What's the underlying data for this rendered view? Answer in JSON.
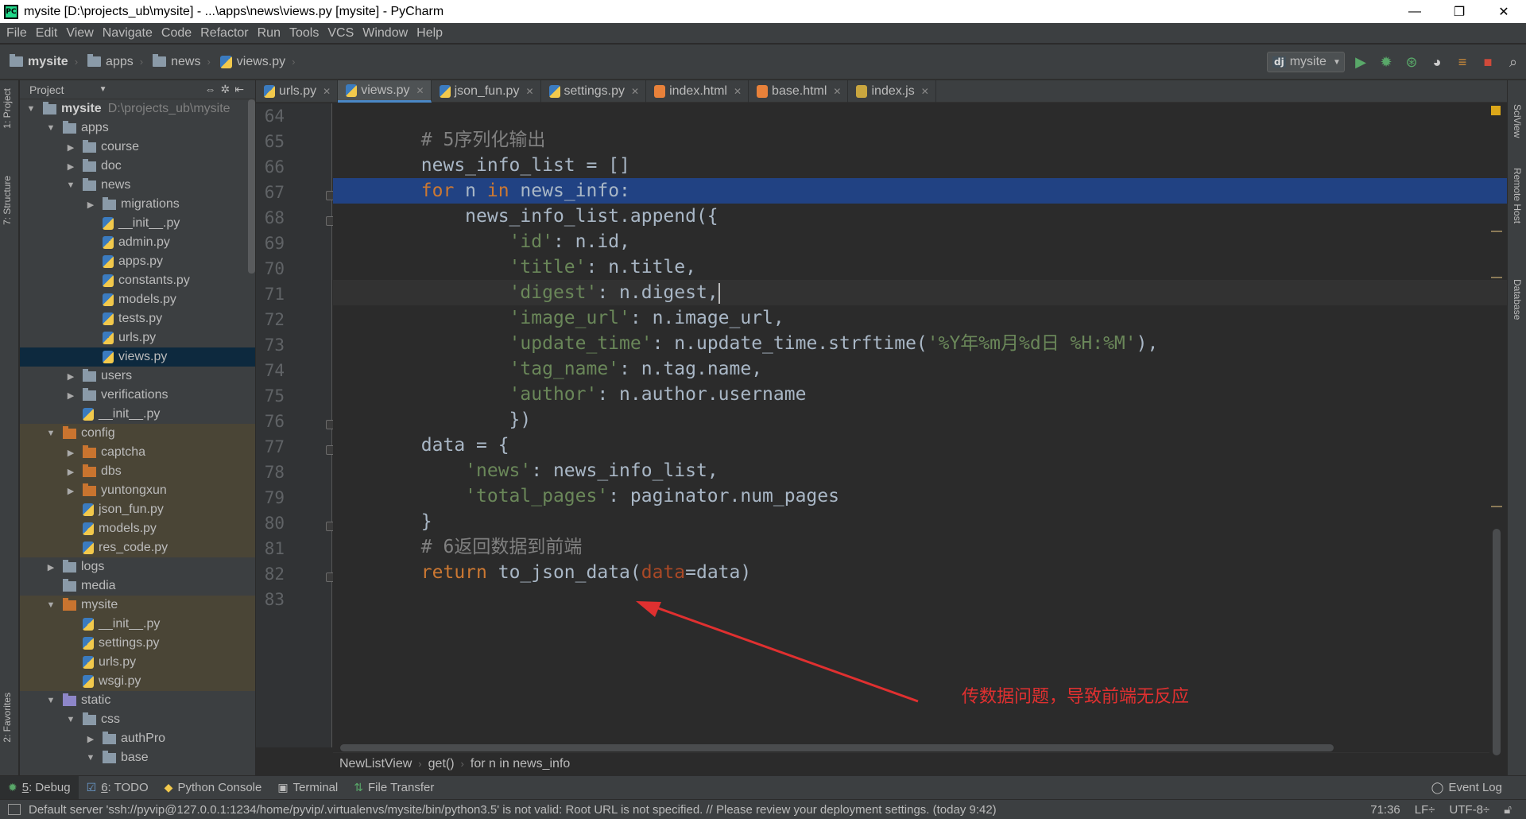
{
  "window": {
    "title": "mysite [D:\\projects_ub\\mysite] - ...\\apps\\news\\views.py [mysite] - PyCharm",
    "controls": [
      "—",
      "❐",
      "✕"
    ]
  },
  "menu": [
    "File",
    "Edit",
    "View",
    "Navigate",
    "Code",
    "Refactor",
    "Run",
    "Tools",
    "VCS",
    "Window",
    "Help"
  ],
  "nav": {
    "crumbs": [
      "mysite",
      "apps",
      "news",
      "views.py"
    ],
    "run_config": "mysite"
  },
  "left_tabs": [
    "1: Project",
    "7: Structure",
    "2: Favorites"
  ],
  "right_tabs": [
    "SciView",
    "Remote Host",
    "Database"
  ],
  "project": {
    "header": "Project",
    "root_name": "mysite",
    "root_path": "D:\\projects_ub\\mysite",
    "tree": [
      {
        "label": "apps",
        "type": "folder"
      },
      {
        "label": "course",
        "type": "folder"
      },
      {
        "label": "doc",
        "type": "folder"
      },
      {
        "label": "news",
        "type": "folder"
      },
      {
        "label": "migrations",
        "type": "folder"
      },
      {
        "label": "__init__.py",
        "type": "py"
      },
      {
        "label": "admin.py",
        "type": "py"
      },
      {
        "label": "apps.py",
        "type": "py"
      },
      {
        "label": "constants.py",
        "type": "py"
      },
      {
        "label": "models.py",
        "type": "py"
      },
      {
        "label": "tests.py",
        "type": "py"
      },
      {
        "label": "urls.py",
        "type": "py"
      },
      {
        "label": "views.py",
        "type": "py"
      },
      {
        "label": "users",
        "type": "folder"
      },
      {
        "label": "verifications",
        "type": "folder"
      },
      {
        "label": "__init__.py",
        "type": "py"
      },
      {
        "label": "config",
        "type": "folder"
      },
      {
        "label": "captcha",
        "type": "folder"
      },
      {
        "label": "dbs",
        "type": "folder"
      },
      {
        "label": "yuntongxun",
        "type": "folder"
      },
      {
        "label": "json_fun.py",
        "type": "py"
      },
      {
        "label": "models.py",
        "type": "py"
      },
      {
        "label": "res_code.py",
        "type": "py"
      },
      {
        "label": "logs",
        "type": "folder"
      },
      {
        "label": "media",
        "type": "folder"
      },
      {
        "label": "mysite",
        "type": "folder"
      },
      {
        "label": "__init__.py",
        "type": "py"
      },
      {
        "label": "settings.py",
        "type": "py"
      },
      {
        "label": "urls.py",
        "type": "py"
      },
      {
        "label": "wsgi.py",
        "type": "py"
      },
      {
        "label": "static",
        "type": "folder"
      },
      {
        "label": "css",
        "type": "folder"
      },
      {
        "label": "authPro",
        "type": "folder"
      },
      {
        "label": "base",
        "type": "folder"
      }
    ]
  },
  "tabs": [
    "urls.py",
    "views.py",
    "json_fun.py",
    "settings.py",
    "index.html",
    "base.html",
    "index.js"
  ],
  "code": {
    "line_numbers": [
      "64",
      "65",
      "66",
      "67",
      "68",
      "69",
      "70",
      "71",
      "72",
      "73",
      "74",
      "75",
      "76",
      "77",
      "78",
      "79",
      "80",
      "81",
      "82",
      "83"
    ]
  },
  "annotation": "传数据问题，导致前端无反应",
  "breadcrumbs": [
    "NewListView",
    "get()",
    "for n in news_info"
  ],
  "toolwindows": [
    {
      "key": "5",
      "label": ": Debug"
    },
    {
      "key": "6",
      "label": ": TODO"
    },
    {
      "key": "",
      "label": "Python Console"
    },
    {
      "key": "",
      "label": "Terminal"
    },
    {
      "key": "",
      "label": "File Transfer"
    }
  ],
  "event_log": "Event Log",
  "status": {
    "message": "Default server 'ssh://pyvip@127.0.0.1:1234/home/pyvip/.virtualenvs/mysite/bin/python3.5' is not valid: Root URL is not specified. // Please review your deployment settings. (today 9:42)",
    "position": "71:36",
    "line_sep": "LF÷",
    "encoding": "UTF-8÷"
  },
  "colors": {
    "selection": "#214283",
    "keyword": "#cc7832",
    "string": "#6a8759",
    "comment": "#808080",
    "annotation": "#e03030"
  }
}
